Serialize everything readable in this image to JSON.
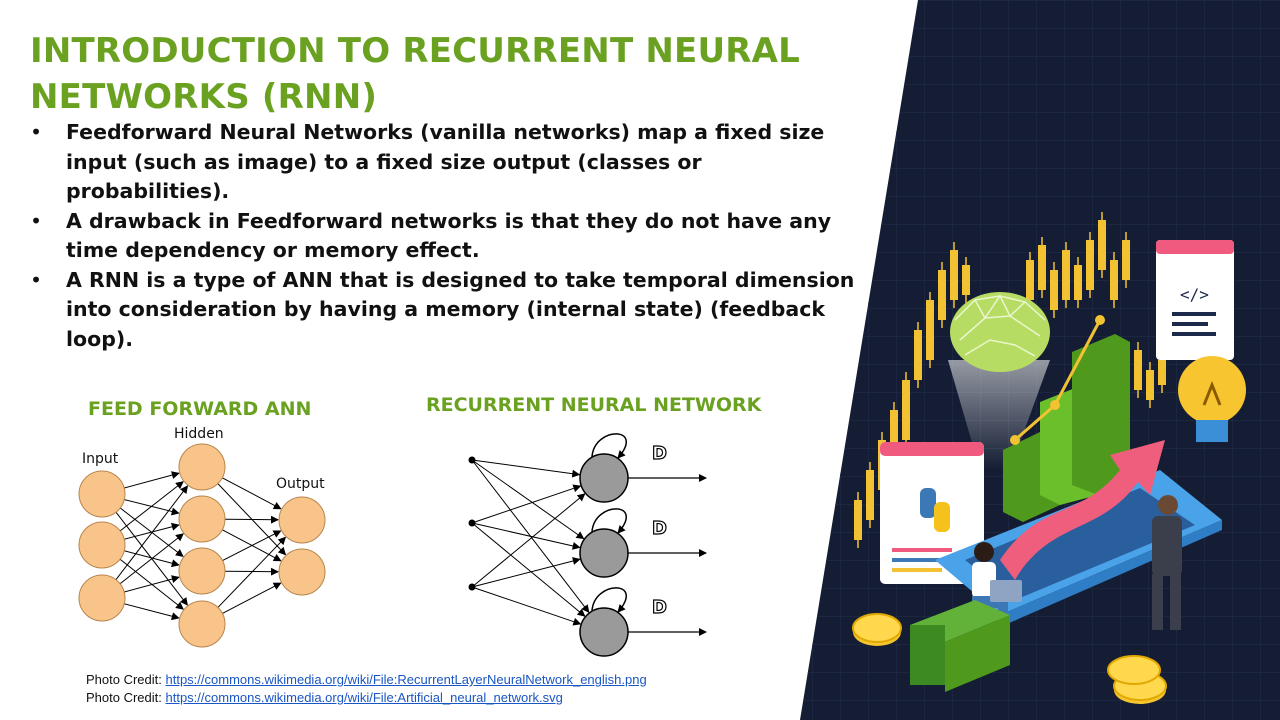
{
  "slide": {
    "title_line1": "INTRODUCTION TO RECURRENT NEURAL",
    "title_line2": "NETWORKS (RNN)",
    "bullet_char": "•",
    "bullets": [
      "Feedforward Neural Networks (vanilla networks) map a fixed size input (such as image) to a fixed size output (classes or probabilities).",
      "A drawback in Feedforward networks is that they do not have any time dependency or memory effect.",
      "A RNN is a type of ANN that is designed to take temporal dimension into consideration by having a memory (internal state) (feedback loop)."
    ],
    "colors": {
      "title": "#6aa121",
      "text": "#111111",
      "node_ff": "#f9c489",
      "node_rnn": "#9a9a9a",
      "link": "#1a56c4",
      "hero_bg": "#141d33"
    }
  },
  "feedforward": {
    "title": "FEED FORWARD ANN",
    "input_label": "Input",
    "hidden_label": "Hidden",
    "output_label": "Output"
  },
  "rnn": {
    "title": "RECURRENT NEURAL NETWORK",
    "delay_label": "D"
  },
  "credits": [
    {
      "prefix": "Photo  Credit: ",
      "url": "https://commons.wikimedia.org/wiki/File:RecurrentLayerNeuralNetwork_english.png"
    },
    {
      "prefix": "Photo  Credit: ",
      "url": "https://commons.wikimedia.org/wiki/File:Artificial_neural_network.svg"
    }
  ],
  "hero": {
    "icons": [
      "brain-icon",
      "bar-chart-icon",
      "code-window-icon",
      "lightbulb-icon",
      "python-logo-icon",
      "laptop-icon",
      "coin-icon",
      "money-stack-icon",
      "person-icon"
    ]
  }
}
